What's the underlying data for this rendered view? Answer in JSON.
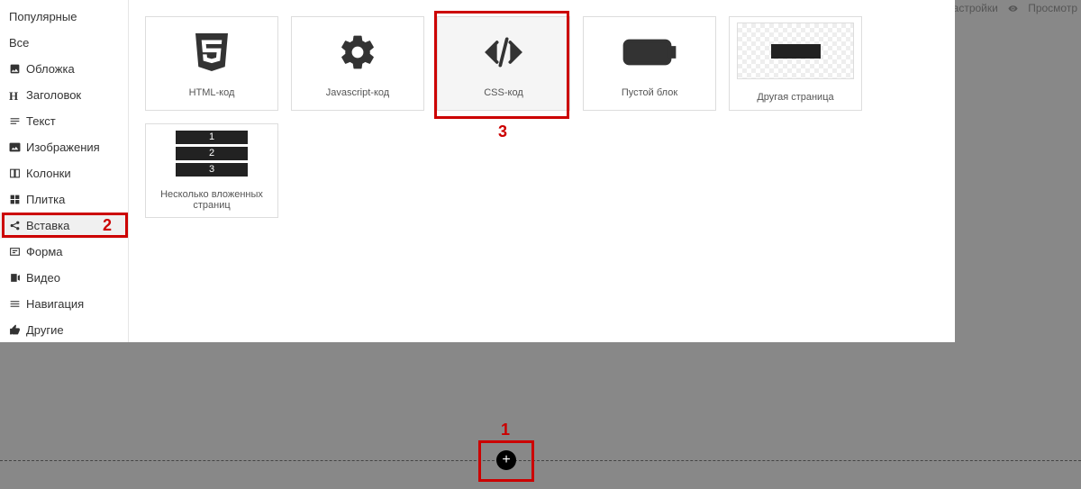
{
  "top": {
    "settings": "Настройки",
    "preview": "Просмотр"
  },
  "sidebar": {
    "items": [
      {
        "label": "Популярные"
      },
      {
        "label": "Все"
      },
      {
        "label": "Обложка"
      },
      {
        "label": "Заголовок"
      },
      {
        "label": "Текст"
      },
      {
        "label": "Изображения"
      },
      {
        "label": "Колонки"
      },
      {
        "label": "Плитка"
      },
      {
        "label": "Вставка"
      },
      {
        "label": "Форма"
      },
      {
        "label": "Видео"
      },
      {
        "label": "Навигация"
      },
      {
        "label": "Другие"
      }
    ]
  },
  "cards": {
    "html": "HTML-код",
    "js": "Javascript-код",
    "css": "CSS-код",
    "empty": "Пустой блок",
    "otherpage": "Другая страница",
    "nested": "Несколько вложенных страниц"
  },
  "nested_nums": {
    "a": "1",
    "b": "2",
    "c": "3"
  },
  "annot": {
    "n1": "1",
    "n2": "2",
    "n3": "3"
  },
  "plus": "+"
}
